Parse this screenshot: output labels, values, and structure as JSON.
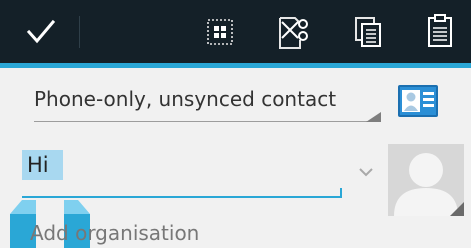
{
  "action_bar": {
    "done_icon": "check-icon",
    "select_all_icon": "select-all-icon",
    "cut_icon": "scissors-icon",
    "copy_icon": "copy-icon",
    "paste_icon": "clipboard-icon",
    "accent_color": "#2aa7d6",
    "background_color": "#142028"
  },
  "account": {
    "label": "Phone-only, unsynced contact",
    "contacts_icon": "contact-card-icon"
  },
  "name_field": {
    "value": "Hi",
    "selected": true,
    "expand_icon": "chevron-down-icon"
  },
  "photo": {
    "icon": "avatar-placeholder-icon"
  },
  "add_organisation": {
    "label": "Add organisation"
  }
}
